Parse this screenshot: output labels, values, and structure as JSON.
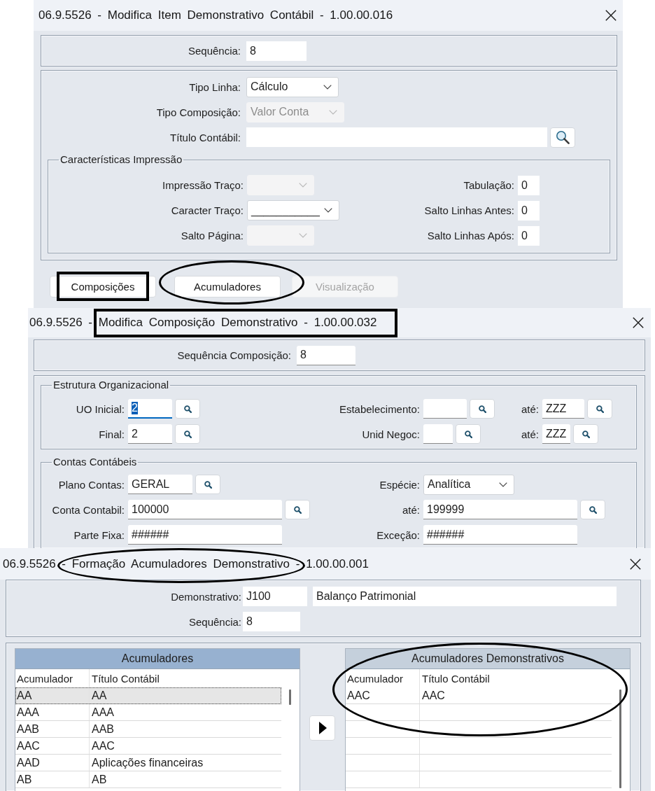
{
  "item_window": {
    "title": "06.9.5526 - Modifica Item Demonstrativo Contábil - 1.00.00.016",
    "sequence": {
      "label": "Sequência:",
      "value": "8"
    },
    "fields": [
      {
        "label": "Tipo Linha:",
        "kind": "select",
        "value": "Cálculo",
        "disabled": false
      },
      {
        "label": "Tipo Composição:",
        "kind": "select",
        "value": "Valor Conta",
        "disabled": true
      },
      {
        "label": "Título Contábil:",
        "kind": "lookup"
      }
    ],
    "print_group": {
      "legend": "Características Impressão",
      "left": [
        {
          "label": "Impressão Traço:",
          "kind": "select",
          "disabled": true
        },
        {
          "label": "Caracter Traço:",
          "kind": "select",
          "value": "___________",
          "disabled": false
        },
        {
          "label": "Salto Página:",
          "kind": "select",
          "disabled": true
        }
      ],
      "right": [
        {
          "label": "Tabulação:",
          "kind": "text",
          "value": "0"
        },
        {
          "label": "Salto Linhas Antes:",
          "kind": "text",
          "value": "0"
        },
        {
          "label": "Salto Linhas Após:",
          "kind": "text",
          "value": "0"
        }
      ]
    },
    "buttons": [
      {
        "label": "Composições",
        "disabled": false,
        "boxed": true,
        "circled": false
      },
      {
        "label": "Acumuladores",
        "disabled": false,
        "boxed": false,
        "circled": true
      },
      {
        "label": "Visualização",
        "disabled": true,
        "boxed": false,
        "circled": false
      }
    ]
  },
  "composition_window": {
    "title": "06.9.5526 - Modifica Composição Demonstrativo - 1.00.00.032",
    "title_boxed": true,
    "sequence": {
      "label": "Sequência Composição:",
      "value": "8"
    },
    "org_group": {
      "legend": "Estrutura Organizacional",
      "rows": [
        [
          {
            "label": "UO Inicial:",
            "kind": "lookup",
            "value": "2",
            "focused": true
          },
          {
            "label": "Estabelecimento:",
            "kind": "lookup",
            "focused": false
          },
          {
            "label": "até:",
            "kind": "lookup",
            "value": "ZZZ",
            "focused": false
          }
        ],
        [
          {
            "label": "Final:",
            "kind": "lookup",
            "value": "2",
            "focused": false
          },
          {
            "label": "Unid Negoc:",
            "kind": "lookup",
            "focused": false
          },
          {
            "label": "até:",
            "kind": "lookup",
            "value": "ZZZ",
            "focused": false
          }
        ]
      ]
    },
    "accounts_group": {
      "legend": "Contas Contábeis",
      "rows": [
        [
          {
            "label": "Plano Contas:",
            "kind": "lookup",
            "value": "GERAL"
          },
          {
            "label": "Espécie:",
            "kind": "select",
            "value": "Analítica",
            "disabled": false
          }
        ],
        [
          {
            "label": "Conta Contabil:",
            "kind": "lookup",
            "value": "100000"
          },
          {
            "label": "até:",
            "kind": "lookup",
            "value": "199999"
          }
        ],
        [
          {
            "label": "Parte Fixa:",
            "kind": "text",
            "value": "######"
          },
          {
            "label": "Exceção:",
            "kind": "text",
            "value": "######"
          }
        ]
      ]
    }
  },
  "accumulators_window": {
    "title": "06.9.5526 - Formação Acumuladores Demonstrativo - 1.00.00.001",
    "title_circled": true,
    "statement": {
      "label": "Demonstrativo:",
      "code": "J100",
      "name": "Balanço Patrimonial"
    },
    "sequence": {
      "label": "Sequência:",
      "value": "8"
    },
    "available": {
      "title": "Acumuladores",
      "focused": true,
      "circled": false,
      "columns": [
        "Acumulador",
        "Título Contábil"
      ],
      "rows": [
        {
          "cells": [
            "AA",
            "AA"
          ],
          "selected": true
        },
        {
          "cells": [
            "AAA",
            "AAA"
          ],
          "selected": false
        },
        {
          "cells": [
            "AAB",
            "AAB"
          ],
          "selected": false
        },
        {
          "cells": [
            "AAC",
            "AAC"
          ],
          "selected": false
        },
        {
          "cells": [
            "AAD",
            "Aplicações financeiras"
          ],
          "selected": false
        },
        {
          "cells": [
            "AB",
            "AB"
          ],
          "selected": false
        }
      ]
    },
    "chosen": {
      "title": "Acumuladores Demonstrativos",
      "focused": false,
      "circled": true,
      "columns": [
        "Acumulador",
        "Título Contábil"
      ],
      "rows": [
        {
          "cells": [
            "AAC",
            "AAC"
          ],
          "selected": false
        }
      ]
    }
  }
}
